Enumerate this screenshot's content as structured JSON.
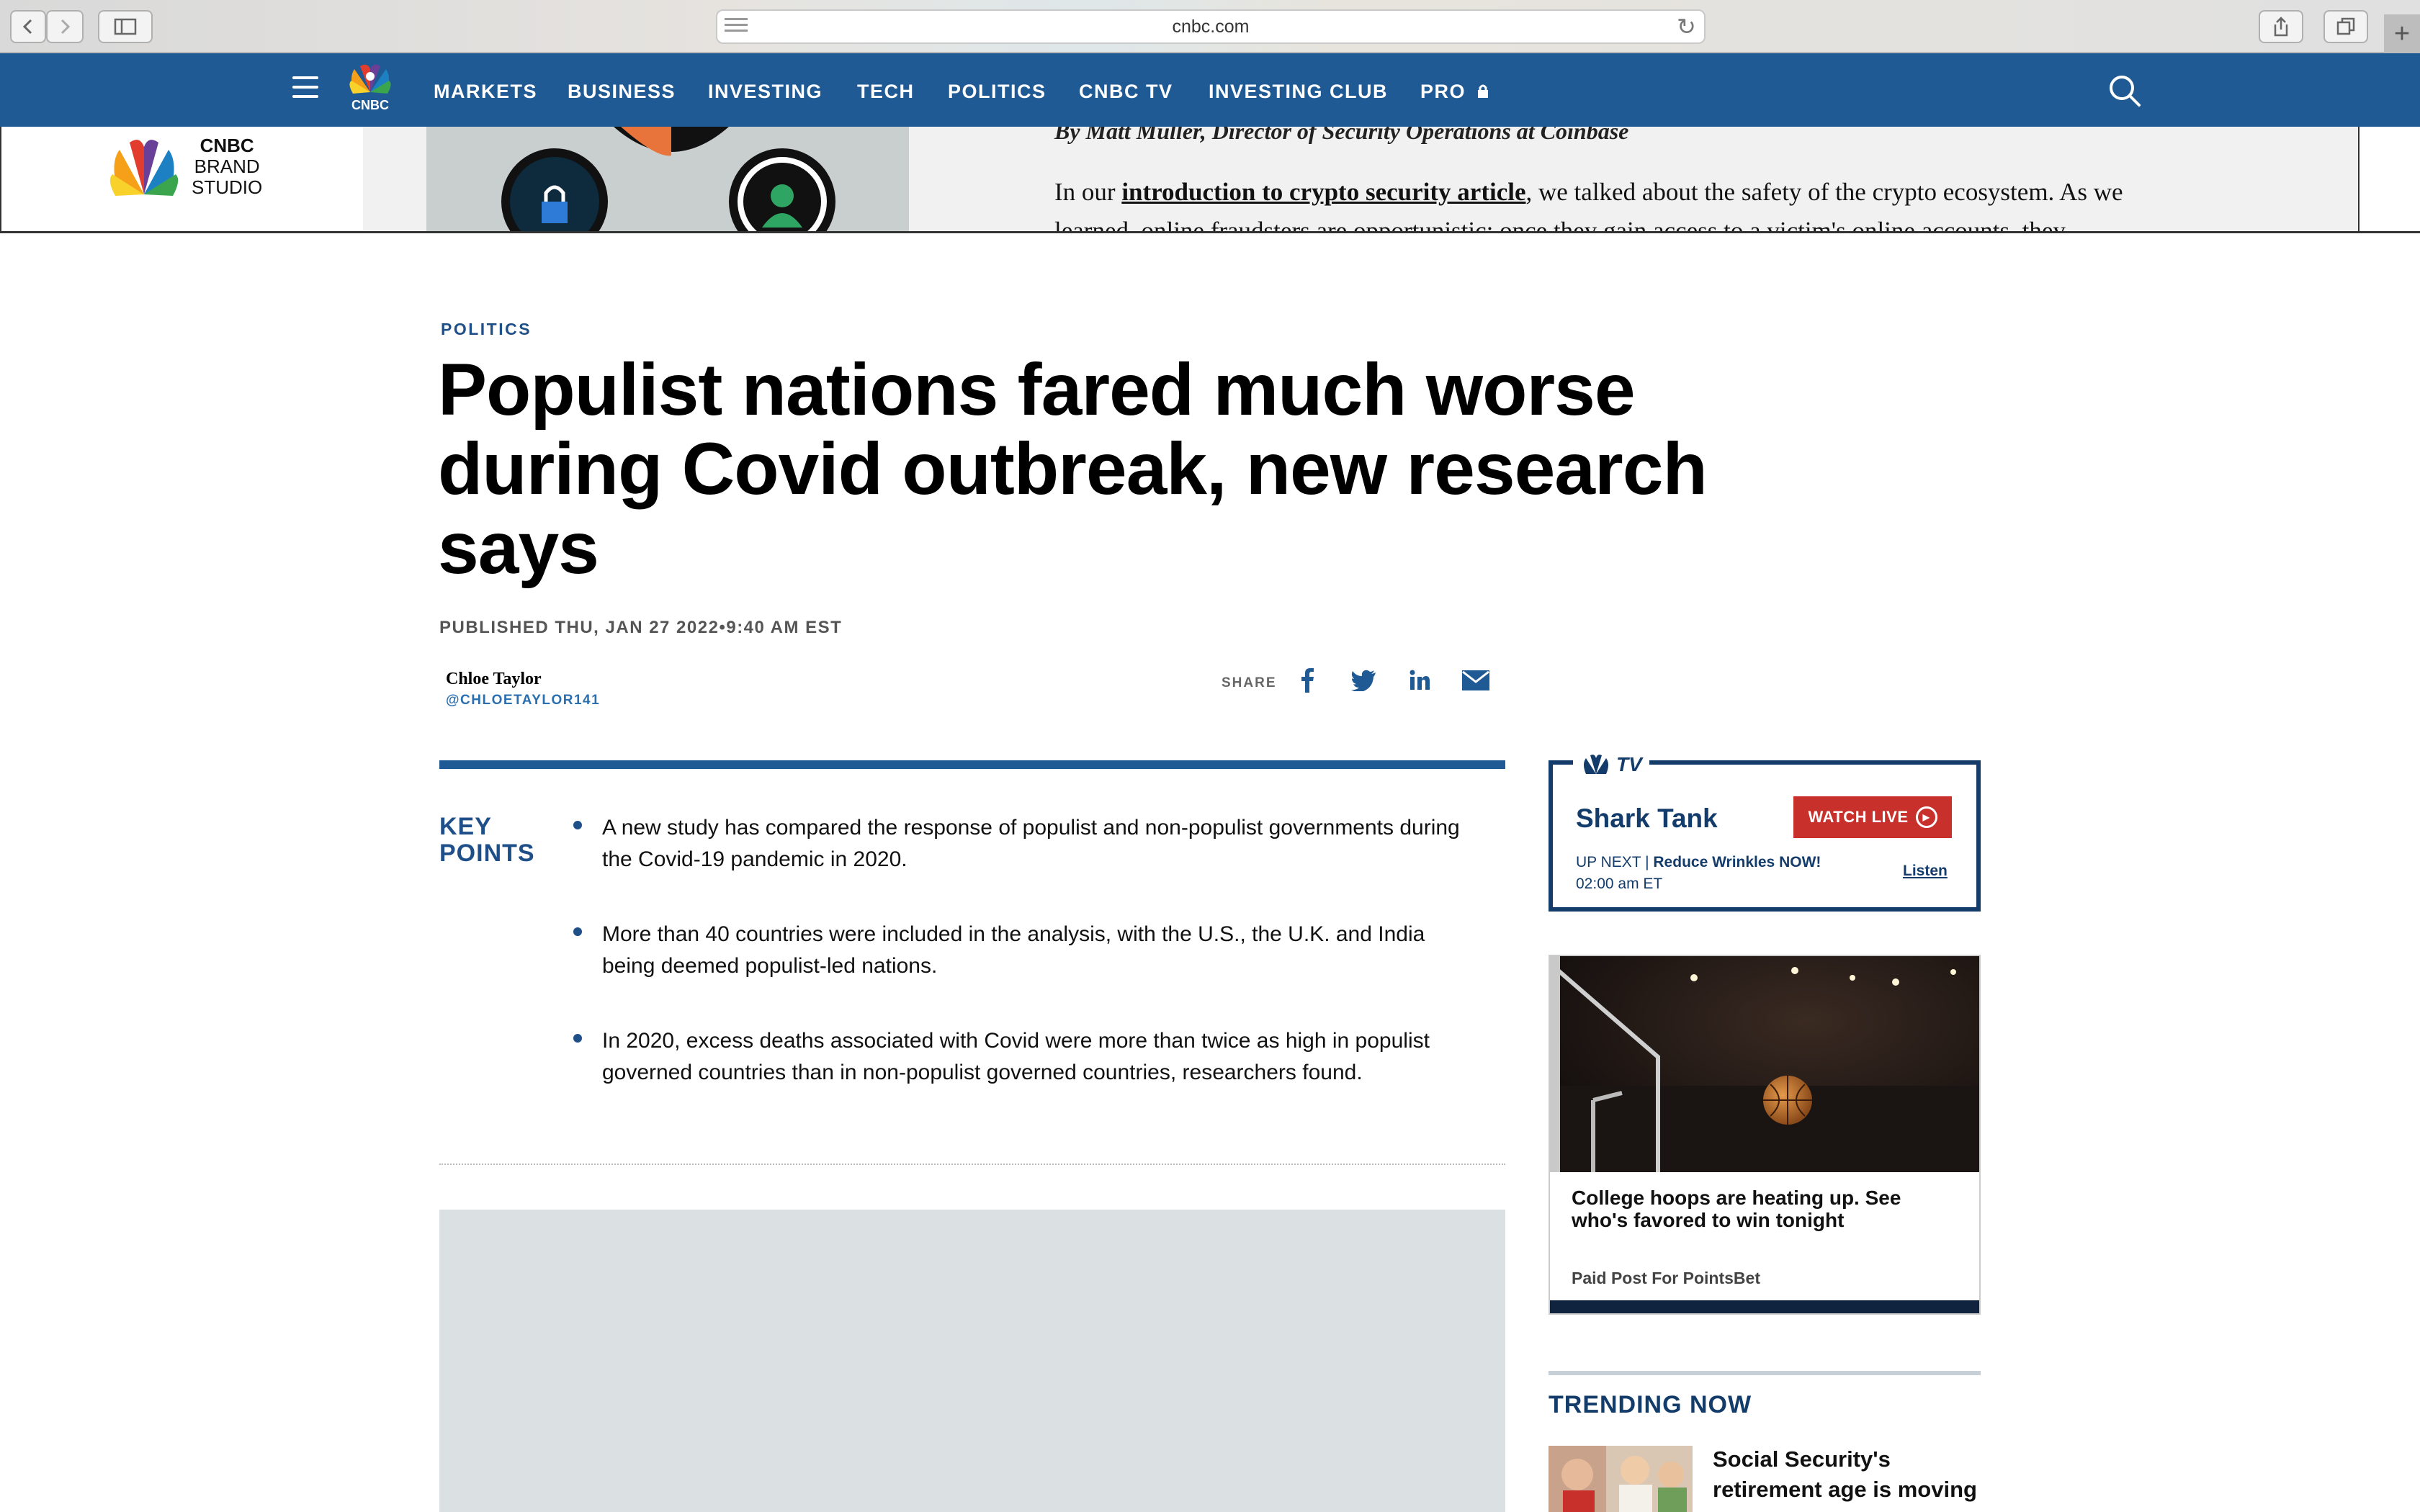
{
  "browser": {
    "url": "cnbc.com"
  },
  "nav": {
    "items": [
      "MARKETS",
      "BUSINESS",
      "INVESTING",
      "TECH",
      "POLITICS",
      "CNBC TV",
      "INVESTING CLUB",
      "PRO"
    ],
    "logo_text": "CNBC"
  },
  "ad": {
    "brand_line1": "CNBC",
    "brand_line2": "BRAND",
    "brand_line3": "STUDIO",
    "byline": "By Matt Muller, Director of Security Operations at Coinbase",
    "para_prefix": "In our ",
    "para_link": "introduction to crypto security article",
    "para_suffix": ", we talked about the safety of the crypto ecosystem. As we learned, online fraudsters are opportunistic; once they gain access to a victim's online accounts, they"
  },
  "article": {
    "section": "POLITICS",
    "headline": "Populist nations fared much worse during Covid outbreak, new research says",
    "published": "PUBLISHED THU, JAN 27 2022•9:40 AM EST",
    "author": "Chloe Taylor",
    "handle": "@CHLOETAYLOR141",
    "share_label": "SHARE",
    "key_points_title_1": "KEY",
    "key_points_title_2": "POINTS",
    "key_points": [
      "A new study has compared the response of populist and non-populist governments during the Covid-19 pandemic in 2020.",
      "More than 40 countries were included in the analysis, with the U.S., the U.K. and India being deemed populist-led nations.",
      "In 2020, excess deaths associated with Covid were more than twice as high in populist governed countries than in non-populist governed countries, researchers found."
    ]
  },
  "sidebar": {
    "tv_label": "TV",
    "show": "Shark Tank",
    "watch_live": "WATCH LIVE",
    "up_next_prefix": "UP NEXT | ",
    "up_next_title": "Reduce Wrinkles NOW!",
    "up_next_time": "02:00 am ET",
    "listen": "Listen",
    "promo_title": "College hoops are heating up. See who's favored to win tonight",
    "promo_paid": "Paid Post For PointsBet",
    "trending_title": "TRENDING NOW",
    "trending_item": "Social Security's retirement age is moving"
  },
  "colors": {
    "nav": "#1f5a94",
    "accent": "#1f4f88",
    "live": "#c8312b"
  }
}
